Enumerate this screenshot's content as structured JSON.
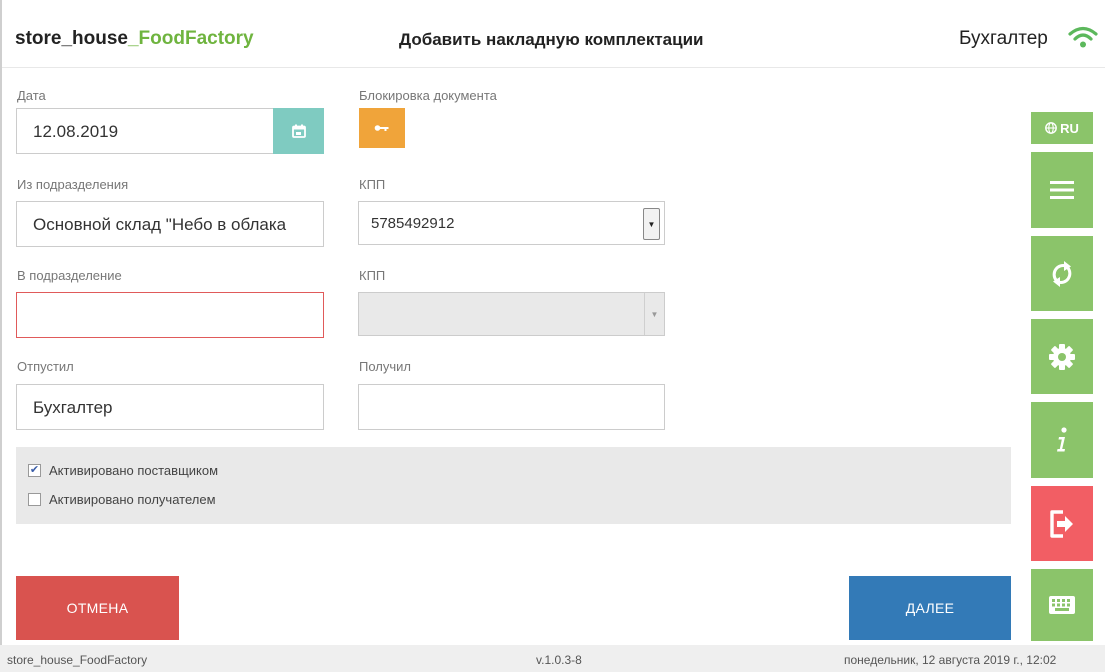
{
  "header": {
    "brand_main": "store_house",
    "brand_accent": "_FoodFactory",
    "title": "Добавить накладную комплектации",
    "user": "Бухгалтер"
  },
  "form": {
    "date_label": "Дата",
    "date_value": "12.08.2019",
    "lock_label": "Блокировка документа",
    "from_label": "Из подразделения",
    "from_value": "Основной склад \"Небо в облака",
    "kpp1_label": "КПП",
    "kpp1_value": "5785492912",
    "to_label": "В подразделение",
    "to_value": "",
    "kpp2_label": "КПП",
    "kpp2_value": "",
    "released_label": "Отпустил",
    "released_value": "Бухгалтер",
    "received_label": "Получил",
    "received_value": ""
  },
  "checks": [
    {
      "label": "Активировано поставщиком",
      "checked": true
    },
    {
      "label": "Активировано получателем",
      "checked": false
    }
  ],
  "buttons": {
    "cancel": "ОТМЕНА",
    "next": "ДАЛЕЕ"
  },
  "toolbar": {
    "lang": "RU",
    "icons": [
      "menu-icon",
      "sync-icon",
      "gear-icon",
      "info-icon",
      "logout-icon",
      "keyboard-icon"
    ]
  },
  "footer": {
    "app": "store_house_FoodFactory",
    "version": "v.1.0.3-8",
    "datetime": "понедельник, 12 августа 2019 г., 12:02"
  },
  "colors": {
    "accent_green": "#8bc46a",
    "brand_green": "#6fb43f",
    "cancel_red": "#d9534f",
    "next_blue": "#337ab7",
    "logout_red": "#f25e64",
    "lock_orange": "#f0a43a",
    "calendar_teal": "#7fcbc1"
  }
}
